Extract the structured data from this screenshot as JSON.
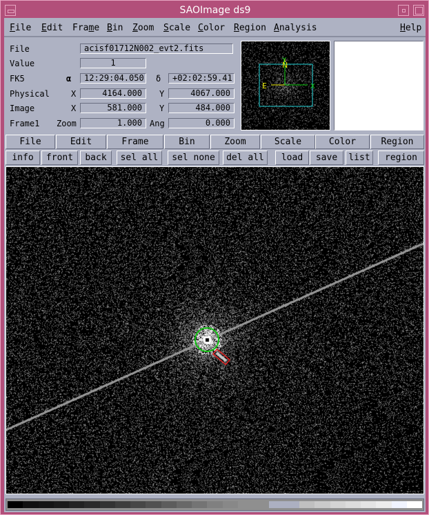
{
  "window": {
    "title": "SAOImage ds9"
  },
  "menubar": {
    "items": [
      {
        "label": "File",
        "mnemonic": "F"
      },
      {
        "label": "Edit",
        "mnemonic": "E"
      },
      {
        "label": "Frame",
        "mnemonic": "m"
      },
      {
        "label": "Bin",
        "mnemonic": "B"
      },
      {
        "label": "Zoom",
        "mnemonic": "Z"
      },
      {
        "label": "Scale",
        "mnemonic": "S"
      },
      {
        "label": "Color",
        "mnemonic": "C"
      },
      {
        "label": "Region",
        "mnemonic": "R"
      },
      {
        "label": "Analysis",
        "mnemonic": "A"
      }
    ],
    "help": {
      "label": "Help",
      "mnemonic": "H"
    }
  },
  "info": {
    "file_label": "File",
    "file_value": "acisf01712N002_evt2.fits",
    "value_label": "Value",
    "value_value": "1",
    "fk5_label": "FK5",
    "alpha_label": "α",
    "alpha_value": "12:29:04.050",
    "delta_label": "δ",
    "delta_value": "+02:02:59.41",
    "physical_label": "Physical",
    "physical_x_label": "X",
    "physical_x_value": "4164.000",
    "physical_y_label": "Y",
    "physical_y_value": "4067.000",
    "image_label": "Image",
    "image_x_label": "X",
    "image_x_value": "581.000",
    "image_y_label": "Y",
    "image_y_value": "484.000",
    "frame_label": "Frame1",
    "zoom_label": "Zoom",
    "zoom_value": "1.000",
    "ang_label": "Ang",
    "ang_value": "0.000"
  },
  "panner": {
    "compass": {
      "north": "N",
      "east": "E",
      "x": "X",
      "y": "Y"
    },
    "colors": {
      "box": "#22d3d8",
      "wcs": "#f2f20a",
      "image": "#13d313"
    }
  },
  "buttonbar": {
    "main": [
      "File",
      "Edit",
      "Frame",
      "Bin",
      "Zoom",
      "Scale",
      "Color",
      "Region"
    ],
    "region": [
      "info",
      "front",
      "back",
      "sel all",
      "sel none",
      "del all",
      "load",
      "save",
      "list",
      "region"
    ]
  },
  "image": {
    "regions": [
      {
        "shape": "circle",
        "color": "#14c214"
      },
      {
        "shape": "box",
        "color": "#e02020"
      }
    ]
  },
  "colorbar": {
    "colors": [
      "#000000",
      "#101010",
      "#141414",
      "#1a1a1a",
      "#222222",
      "#2a2a2a",
      "#333333",
      "#3d3d3d",
      "#474747",
      "#515151",
      "#5c5c5c",
      "#686868",
      "#747474",
      "#808080",
      "#888888",
      "#8f8f8f",
      "#8f8f8f",
      "#acb0c1",
      "#acb0c1",
      "#c0c0c0",
      "#cacaca",
      "#d4d4d4",
      "#dcdcdc",
      "#e4e4e4",
      "#ececec",
      "#f0f4ff",
      "#ffffff"
    ]
  }
}
